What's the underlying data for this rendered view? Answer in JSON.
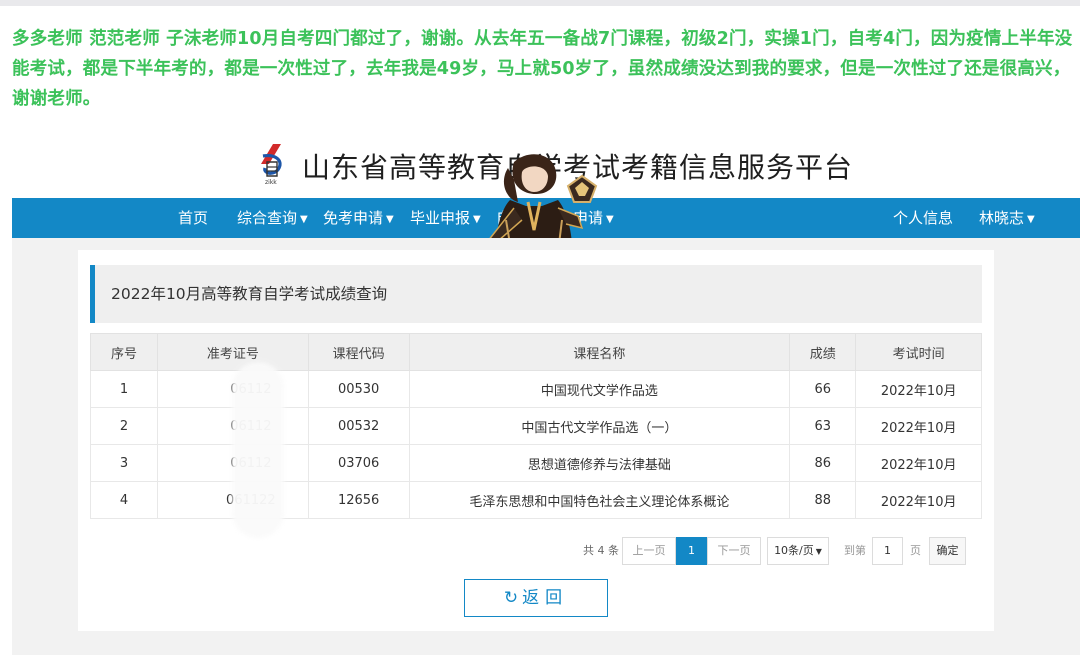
{
  "caption": "多多老师 范范老师 子沫老师10月自考四门都过了，谢谢。从去年五一备战7门课程，初级2门，实操1门，自考4门，因为疫情上半年没能考试，都是下半年考的，都是一次性过了，去年我是49岁，马上就50岁了，虽然成绩没达到我的要求，但是一次性过了还是很高兴，谢谢老师。",
  "site": {
    "title": "山东省高等教育自学考试考籍信息服务平台",
    "logo_text": "zikk"
  },
  "nav": {
    "items": [
      {
        "label": "首页",
        "has_caret": false
      },
      {
        "label": "综合查询",
        "has_caret": true
      },
      {
        "label": "免考申请",
        "has_caret": true
      },
      {
        "label": "毕业申报",
        "has_caret": true
      },
      {
        "label": "自考",
        "has_caret": false
      },
      {
        "label": "申请",
        "has_caret": true
      }
    ],
    "right_items": [
      {
        "label": "个人信息",
        "has_caret": false
      },
      {
        "label": "林晓志",
        "has_caret": true
      }
    ]
  },
  "page": {
    "heading": "2022年10月高等教育自学考试成绩查询"
  },
  "table": {
    "headers": [
      "序号",
      "准考证号",
      "课程代码",
      "课程名称",
      "成绩",
      "考试时间"
    ],
    "rows": [
      {
        "seq": "1",
        "id": "06112",
        "code": "00530",
        "name": "中国现代文学作品选",
        "score": "66",
        "time": "2022年10月"
      },
      {
        "seq": "2",
        "id": "06112",
        "code": "00532",
        "name": "中国古代文学作品选（一）",
        "score": "63",
        "time": "2022年10月"
      },
      {
        "seq": "3",
        "id": "06112",
        "code": "03706",
        "name": "思想道德修养与法律基础",
        "score": "86",
        "time": "2022年10月"
      },
      {
        "seq": "4",
        "id": "061122",
        "code": "12656",
        "name": "毛泽东思想和中国特色社会主义理论体系概论",
        "score": "88",
        "time": "2022年10月"
      }
    ]
  },
  "pager": {
    "total": "共 4 条",
    "prev": "上一页",
    "current": "1",
    "next": "下一页",
    "page_size": "10条/页",
    "goto_label": "到第",
    "goto_value": "1",
    "page_suffix": "页",
    "confirm": "确定"
  },
  "back_button": {
    "label": "返回"
  },
  "colors": {
    "caption_green": "#3cc25a",
    "nav_blue": "#1388c6"
  }
}
